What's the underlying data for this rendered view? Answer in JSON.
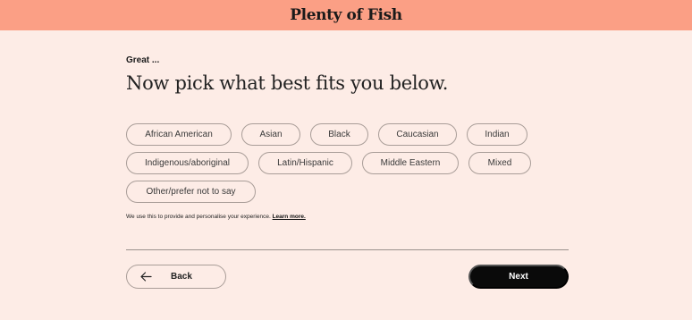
{
  "header": {
    "logo": "Plenty of Fish"
  },
  "intro": {
    "eyebrow": "Great ...",
    "title": "Now pick what best fits you below."
  },
  "options": {
    "row1": [
      "African American",
      "Asian",
      "Black",
      "Caucasian",
      "Indian"
    ],
    "row2": [
      "Indigenous/aboriginal",
      "Latin/Hispanic",
      "Middle Eastern",
      "Mixed"
    ],
    "row3": [
      "Other/prefer not to say"
    ]
  },
  "disclaimer": {
    "text": "We use this to provide and personalise your experience.",
    "link": "Learn more."
  },
  "footer": {
    "back_label": "Back",
    "next_label": "Next"
  },
  "colors": {
    "header_bg": "#fb9f85",
    "page_bg": "#fdece6",
    "next_bg": "#0a0a0a"
  }
}
